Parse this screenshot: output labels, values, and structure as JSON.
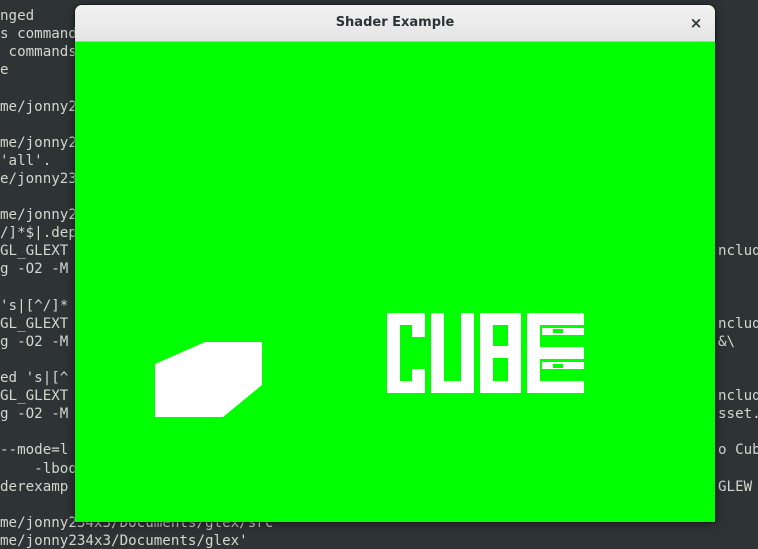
{
  "window": {
    "title": "Shader Example",
    "close_glyph": "×",
    "canvas_background": "#00ff00",
    "canvas_text": "CUBE",
    "foreground_color": "#ffffff"
  },
  "terminal": {
    "left_lines": [
      "nged",
      "s command",
      " commands",
      "e",
      "",
      "me/jonny2",
      "",
      "me/jonny2",
      "'all'.",
      "e/jonny23",
      "",
      "me/jonny2",
      "/]*$|.dep",
      "GL_GLEXT",
      "g -O2 -M",
      "",
      "'s|[^/]*",
      "GL_GLEXT",
      "g -O2 -M",
      "",
      "ed 's|[^",
      "GL_GLEXT",
      "g -O2 -M",
      "",
      "--mode=l",
      "    -lboo",
      "derexamp",
      "",
      "me/jonny234x3/Documents/glex/src'",
      "me/jonny234x3/Documents/glex'"
    ],
    "right_lines": [
      {
        "row": 13,
        "text": "nclud"
      },
      {
        "row": 17,
        "text": "nclud"
      },
      {
        "row": 18,
        "text": "&\\"
      },
      {
        "row": 21,
        "text": "nclud"
      },
      {
        "row": 22,
        "text": "sset."
      },
      {
        "row": 24,
        "text": "o Cub"
      },
      {
        "row": 26,
        "text": "GLEW"
      }
    ]
  }
}
